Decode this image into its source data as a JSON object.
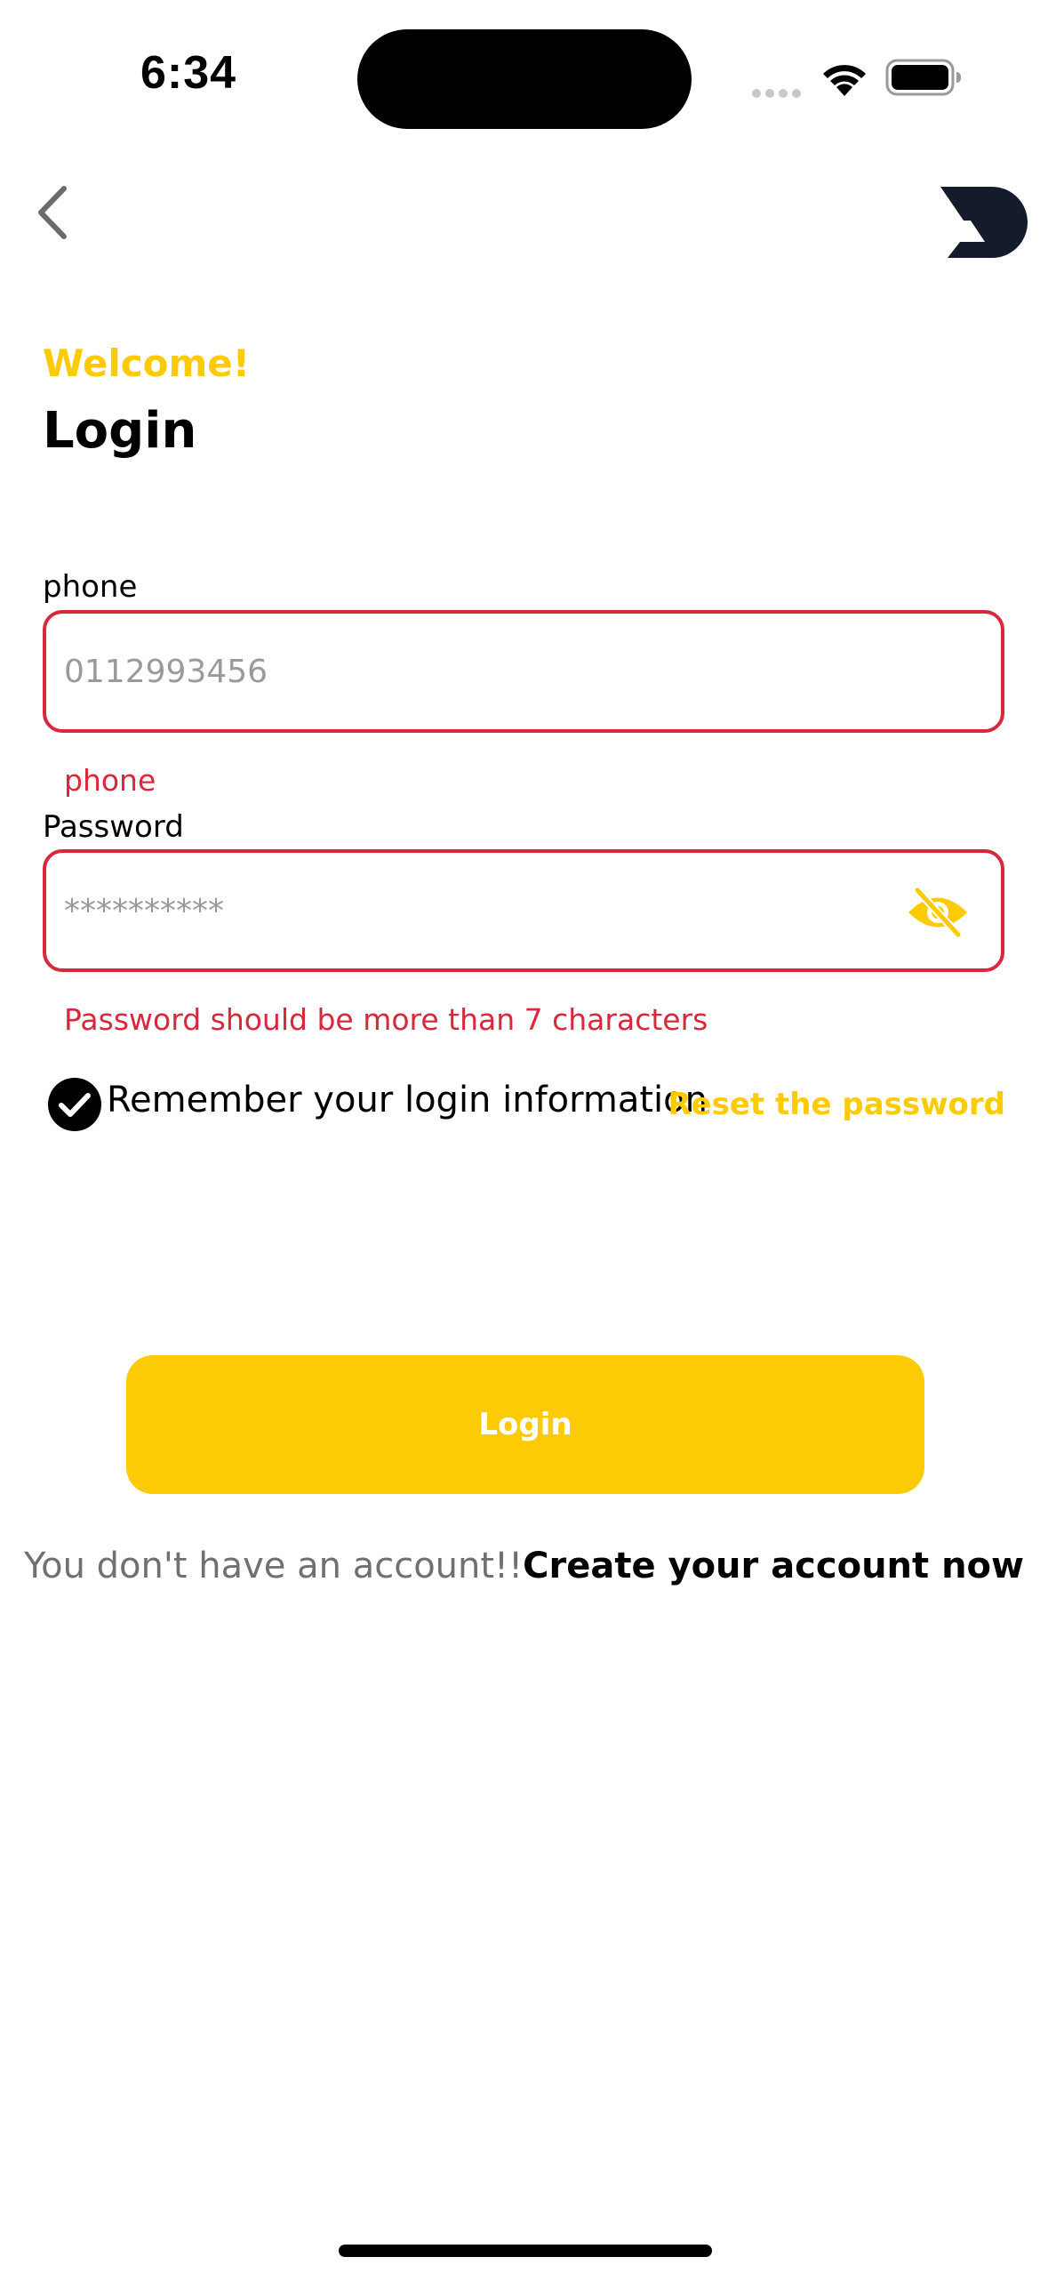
{
  "status_bar": {
    "time": "6:34"
  },
  "header": {
    "welcome": "Welcome!",
    "title": "Login"
  },
  "form": {
    "phone_label": "phone",
    "phone_placeholder": "0112993456",
    "phone_error": "phone",
    "password_label": "Password",
    "password_placeholder": "**********",
    "password_error": "Password should be more than 7 characters",
    "remember_label": "Remember your login information",
    "remember_checked": true,
    "reset_link": "Reset the password"
  },
  "login_button": "Login",
  "signup": {
    "prompt": "You don't have an account!!",
    "link": "Create your account now"
  },
  "colors": {
    "accent": "#fdcb05",
    "error": "#d9273b",
    "logo": "#141b2b"
  },
  "icons": [
    "back-chevron-icon",
    "brand-logo",
    "eye-off-icon",
    "checkmark-circle-icon",
    "wifi-icon",
    "battery-icon"
  ]
}
